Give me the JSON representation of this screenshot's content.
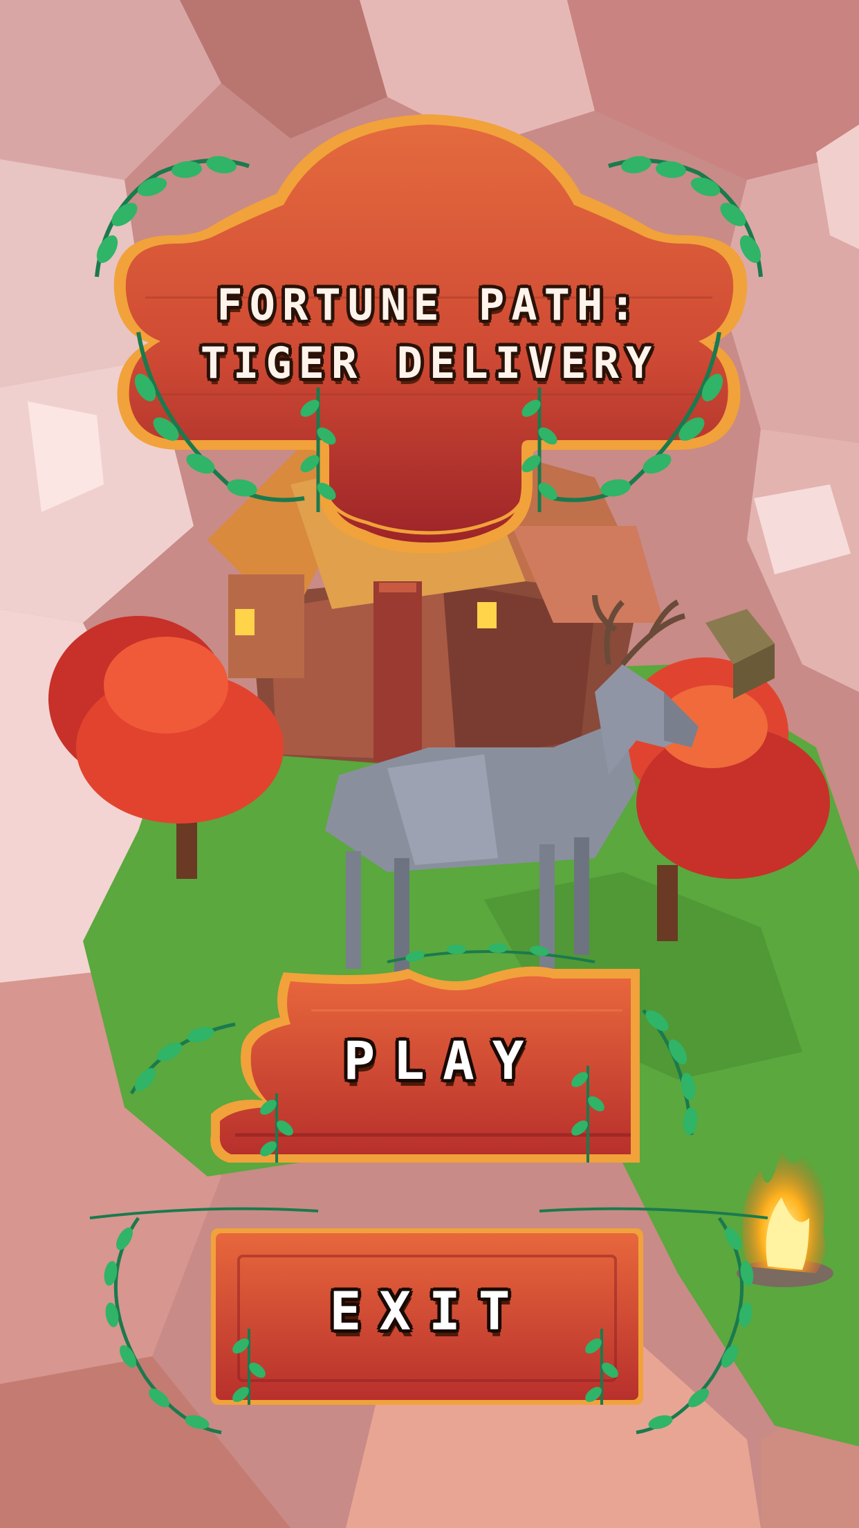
{
  "game": {
    "title_line_1": "FORTUNE PATH:",
    "title_line_2": "TIGER DELIVERY"
  },
  "menu": {
    "play_label": "PLAY",
    "exit_label": "EXIT"
  },
  "colors": {
    "board_main": "#cf4a34",
    "board_dark": "#8e1e22",
    "board_rim": "#f1a23a",
    "leaf": "#2fb468",
    "leaf_dark": "#1a7a4e",
    "grass": "#5aa83e",
    "rock": "#d9a6a6"
  },
  "icons": {
    "deer": "deer-icon",
    "house": "house-icon",
    "campfire": "campfire-icon",
    "tree": "tree-icon",
    "crate": "crate-icon"
  }
}
